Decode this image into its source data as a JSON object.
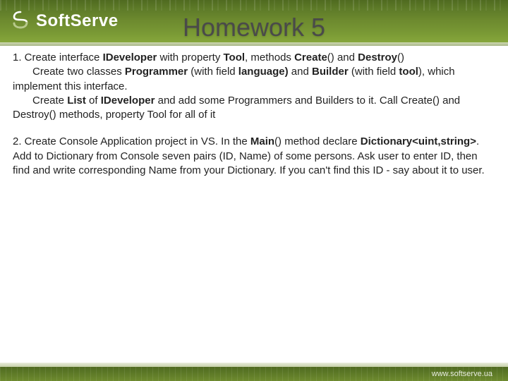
{
  "header": {
    "brand": "SoftServe",
    "title": "Homework 5"
  },
  "task1": {
    "p1a": "1. Create interface ",
    "p1b": "IDeveloper",
    "p1c": " with property ",
    "p1d": "Tool",
    "p1e": ", methods ",
    "p1f": "Create",
    "p1g": "() and ",
    "p1h": "Destroy",
    "p1i": "()",
    "p2a": "Create two classes ",
    "p2b": "Programmer",
    "p2c": " (with field ",
    "p2d": "language)",
    "p2e": " and ",
    "p2f": "Builder",
    "p2g": " (with field ",
    "p2h": "tool",
    "p2i": "), which implement this interface.",
    "p3a": "Create ",
    "p3b": "List",
    "p3c": " of ",
    "p3d": "IDeveloper",
    "p3e": " and add some Programmers and Builders to it. Call Create() and Destroy() methods, property Tool for all of it"
  },
  "task2": {
    "p1a": "2. Create Console Application project in VS. In the ",
    "p1b": "Main",
    "p1c": "() method declare ",
    "p1d": "Dictionary<uint,string>",
    "p1e": ". Add to Dictionary from Console seven pairs (ID, Name) of some persons. Ask user to enter ID, then find and write corresponding Name from your Dictionary. If you can't find this ID - say about it to user."
  },
  "footer": {
    "url": "www.softserve.ua"
  }
}
